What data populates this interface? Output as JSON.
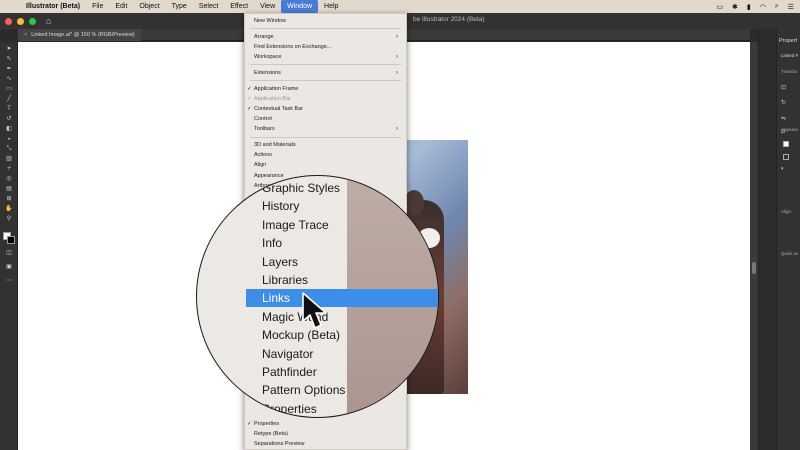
{
  "menubar": {
    "apple": "",
    "items": [
      "Illustrator (Beta)",
      "File",
      "Edit",
      "Object",
      "Type",
      "Select",
      "Effect",
      "View",
      "Window",
      "Help"
    ],
    "status_icons": [
      "window-icon",
      "bluetooth-icon",
      "battery-icon",
      "wifi-icon",
      "search-icon",
      "control-center-icon"
    ]
  },
  "appbar": {
    "traffic_lights": [
      "#ff5f57",
      "#febc2e",
      "#28c840"
    ],
    "title_fragment": "be Illustrator 2024 (Beta)"
  },
  "document_tab": {
    "close": "×",
    "label": "Linked Image.ai* @ 150 % (RGB/Preview)"
  },
  "window_menu": {
    "groups": [
      [
        {
          "label": "New Window"
        }
      ],
      [
        {
          "label": "Arrange",
          "submenu": true
        },
        {
          "label": "Find Extensions on Exchange..."
        },
        {
          "label": "Workspace",
          "submenu": true
        }
      ],
      [
        {
          "label": "Extensions",
          "submenu": true
        }
      ],
      [
        {
          "label": "Application Frame",
          "checked": true
        },
        {
          "label": "Application Bar",
          "checked": true,
          "disabled": true
        },
        {
          "label": "Contextual Task Bar",
          "checked": true
        },
        {
          "label": "Control"
        },
        {
          "label": "Toolbars",
          "submenu": true
        }
      ],
      [
        {
          "label": "3D and Materials"
        },
        {
          "label": "Actions"
        },
        {
          "label": "Align"
        },
        {
          "label": "Appearance"
        },
        {
          "label": "Artboards"
        }
      ]
    ],
    "bottom_items": [
      {
        "label": "Properties",
        "checked": true
      },
      {
        "label": "Retype (Beta)"
      },
      {
        "label": "Separations Preview"
      }
    ]
  },
  "magnifier": {
    "items": [
      {
        "label": "Graphic Styles"
      },
      {
        "label": "History"
      },
      {
        "label": "Image Trace"
      },
      {
        "label": "Info"
      },
      {
        "label": "Layers"
      },
      {
        "label": "Libraries"
      },
      {
        "label": "Links",
        "selected": true
      },
      {
        "label": "Magic Wand"
      },
      {
        "label": "Mockup (Beta)"
      },
      {
        "label": "Navigator"
      },
      {
        "label": "Pathfinder"
      },
      {
        "label": "Pattern Options"
      },
      {
        "label": "Properties",
        "checked": true
      }
    ]
  },
  "right_panel": {
    "header": "Propert",
    "sub": "Linked F",
    "labels": [
      "Transfor",
      "Appeara",
      "Align",
      "Quick ac"
    ]
  },
  "colors": {
    "menu_highlight": "#3d8ee8",
    "menubar_active": "#4a7bd6",
    "toolbar_bg": "#323232",
    "artboard": "#ffffff"
  }
}
